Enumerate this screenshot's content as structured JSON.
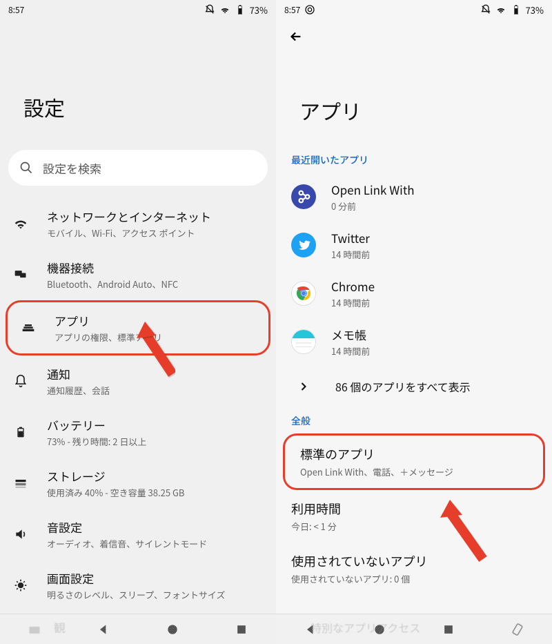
{
  "status": {
    "time": "8:57",
    "battery": "73%"
  },
  "left": {
    "title": "設定",
    "search_placeholder": "設定を検索",
    "items": [
      {
        "title": "ネットワークとインターネット",
        "sub": "モバイル、Wi-Fi、アクセス ポイント"
      },
      {
        "title": "機器接続",
        "sub": "Bluetooth、Android Auto、NFC"
      },
      {
        "title": "アプリ",
        "sub": "アプリの権限、標準アプリ"
      },
      {
        "title": "通知",
        "sub": "通知履歴、会話"
      },
      {
        "title": "バッテリー",
        "sub": "73% - 残り時間: 2 日以上"
      },
      {
        "title": "ストレージ",
        "sub": "使用済み 40% - 空き容量 38.25 GB"
      },
      {
        "title": "音設定",
        "sub": "オーディオ、着信音、サイレントモード"
      },
      {
        "title": "画面設定",
        "sub": "明るさのレベル、スリープ、フォントサイズ"
      }
    ],
    "faded_extra": "観"
  },
  "right": {
    "title": "アプリ",
    "section_recent": "最近開いたアプリ",
    "apps": [
      {
        "title": "Open Link With",
        "sub": "0 分前"
      },
      {
        "title": "Twitter",
        "sub": "14 時間前"
      },
      {
        "title": "Chrome",
        "sub": "14 時間前"
      },
      {
        "title": "メモ帳",
        "sub": "14 時間前"
      }
    ],
    "all_apps": "86 個のアプリをすべて表示",
    "section_general": "全般",
    "prefs": [
      {
        "title": "標準のアプリ",
        "sub": "Open Link With、電話、＋メッセージ"
      },
      {
        "title": "利用時間",
        "sub": "今日: < 1 分"
      },
      {
        "title": "使用されていないアプリ",
        "sub": "使用されていないアプリ: 0 個"
      }
    ],
    "faded_bottom": "特別なアプリアクセス"
  }
}
